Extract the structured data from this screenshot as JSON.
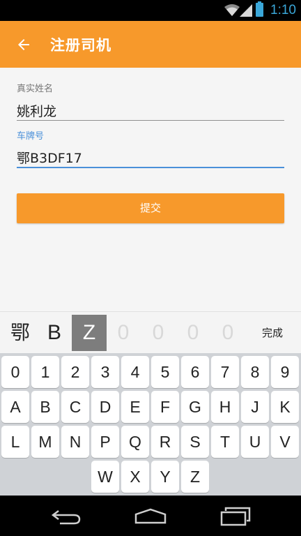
{
  "status_bar": {
    "time": "1:10",
    "icons": [
      "wifi-icon",
      "signal-icon",
      "battery-icon"
    ],
    "accent": "#3aa7d9"
  },
  "app_bar": {
    "title": "注册司机",
    "back_icon": "back-arrow-icon",
    "background": "#f7992b"
  },
  "form": {
    "name_label": "真实姓名",
    "name_value": "姚利龙",
    "plate_label": "车牌号",
    "plate_value": "鄂B3DF17",
    "submit_label": "提交"
  },
  "keyboard": {
    "plate_slots": [
      "鄂",
      "B",
      "Z",
      "0",
      "0",
      "0",
      "0"
    ],
    "active_slot": 2,
    "done_label": "完成",
    "rows": [
      [
        "0",
        "1",
        "2",
        "3",
        "4",
        "5",
        "6",
        "7",
        "8",
        "9"
      ],
      [
        "A",
        "B",
        "C",
        "D",
        "E",
        "F",
        "G",
        "H",
        "J",
        "K"
      ],
      [
        "L",
        "M",
        "N",
        "P",
        "Q",
        "R",
        "S",
        "T",
        "U",
        "V"
      ],
      [
        "W",
        "X",
        "Y",
        "Z"
      ]
    ]
  },
  "nav_bar": {
    "icons": [
      "back-nav-icon",
      "home-nav-icon",
      "recents-nav-icon"
    ]
  }
}
